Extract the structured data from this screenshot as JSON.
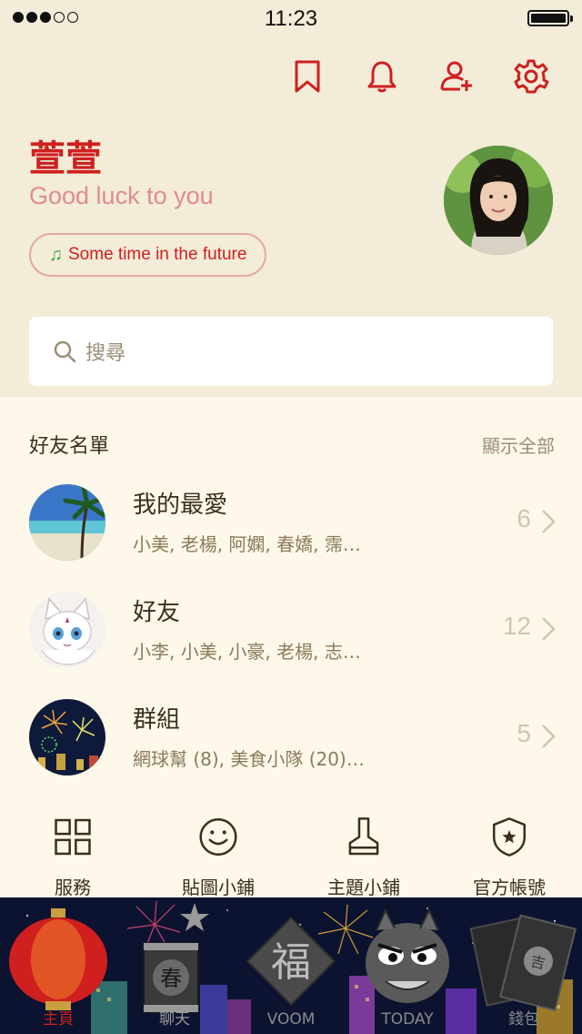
{
  "status_bar": {
    "time": "11:23"
  },
  "header": {
    "icons": [
      "bookmark-icon",
      "bell-icon",
      "add-friend-icon",
      "settings-icon"
    ],
    "accent_color": "#cf1f1f"
  },
  "profile": {
    "name": "萱萱",
    "status_message": "Good luck to you",
    "music": "Some time in the future"
  },
  "search": {
    "placeholder": "搜尋"
  },
  "friends": {
    "title": "好友名單",
    "show_all": "顯示全部",
    "rows": [
      {
        "title": "我的最愛",
        "members": "小美, 老楊, 阿嫻, 春嬌, 霈…",
        "count": "6"
      },
      {
        "title": "好友",
        "members": "小李, 小美, 小豪, 老楊, 志…",
        "count": "12"
      },
      {
        "title": "群組",
        "members": "網球幫 (8), 美食小隊 (20)…",
        "count": "5"
      }
    ]
  },
  "tiles": [
    {
      "label": "服務",
      "icon": "grid-icon"
    },
    {
      "label": "貼圖小鋪",
      "icon": "smiley-icon"
    },
    {
      "label": "主題小鋪",
      "icon": "brush-icon"
    },
    {
      "label": "官方帳號",
      "icon": "shield-star-icon"
    }
  ],
  "tabbar": {
    "tabs": [
      {
        "label": "主頁",
        "icon": "lantern-icon"
      },
      {
        "label": "聊天",
        "icon": "chun-lantern-icon"
      },
      {
        "label": "VOOM",
        "icon": "fu-diamond-icon"
      },
      {
        "label": "TODAY",
        "icon": "lion-dance-icon"
      },
      {
        "label": "錢包",
        "icon": "red-envelope-icon"
      }
    ],
    "active_color": "#cf1f1f"
  }
}
